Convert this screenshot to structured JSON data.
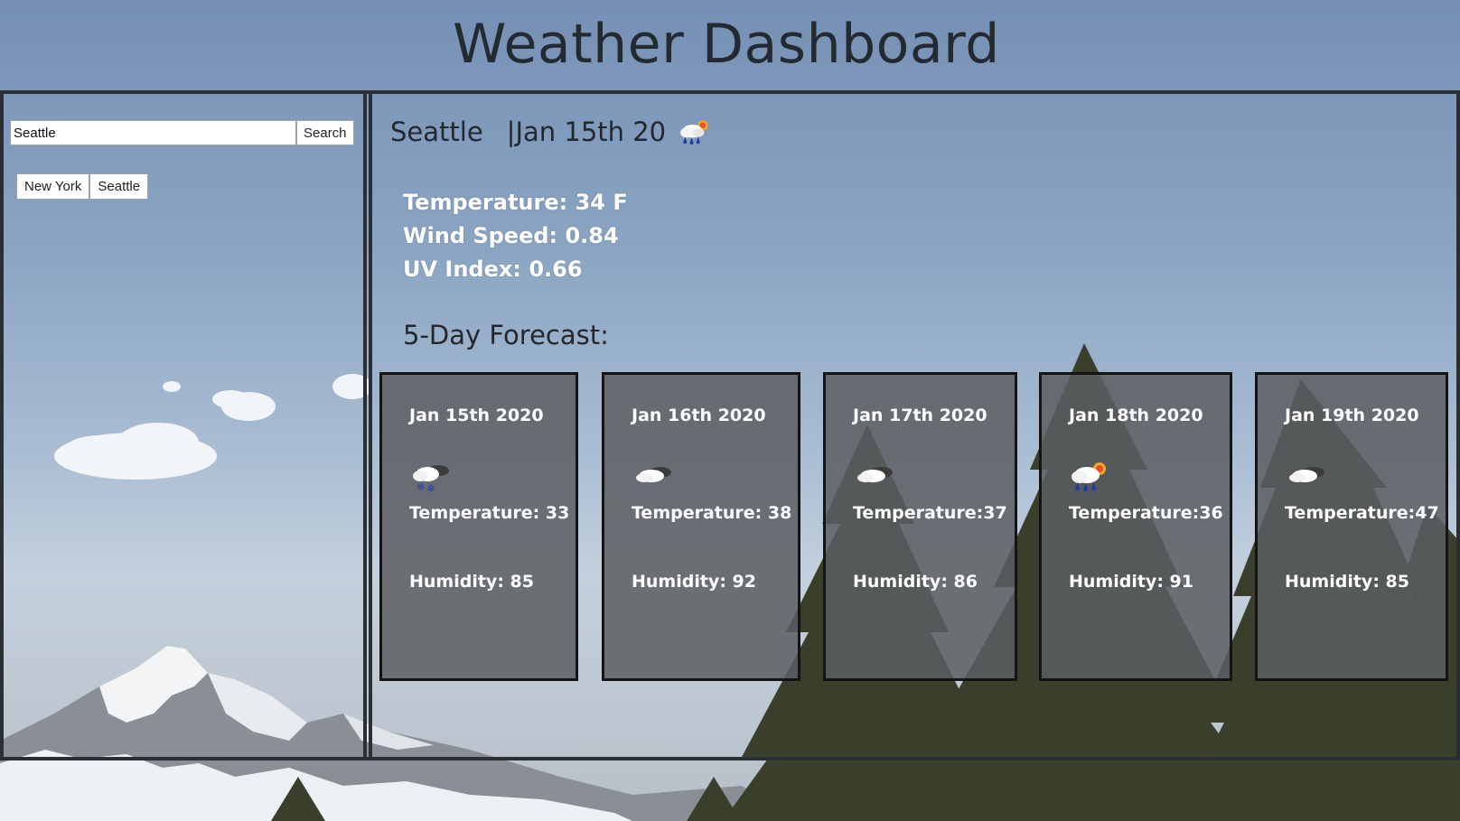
{
  "header": {
    "title": "Weather Dashboard"
  },
  "sidebar": {
    "search": {
      "value": "Seattle",
      "button_label": "Search"
    },
    "history": [
      {
        "label": "New York"
      },
      {
        "label": "Seattle"
      }
    ]
  },
  "current": {
    "city": "Seattle",
    "date": "|Jan 15th 20",
    "icon": "rain-sun-icon",
    "temperature": "Temperature: 34 F",
    "wind_speed": "Wind Speed: 0.84",
    "uv_index": "UV Index: 0.66"
  },
  "forecast": {
    "title": "5-Day Forecast:",
    "days": [
      {
        "date": "Jan 15th 2020",
        "icon": "snow-cloud-icon",
        "temperature": "Temperature: 33",
        "humidity": "Humidity: 85"
      },
      {
        "date": "Jan 16th 2020",
        "icon": "cloud-icon",
        "temperature": "Temperature: 38",
        "humidity": "Humidity: 92"
      },
      {
        "date": "Jan 17th 2020",
        "icon": "cloud-icon",
        "temperature": "Temperature:37",
        "humidity": "Humidity: 86"
      },
      {
        "date": "Jan 18th 2020",
        "icon": "rain-sun-icon",
        "temperature": "Temperature:36",
        "humidity": "Humidity: 91"
      },
      {
        "date": "Jan 19th 2020",
        "icon": "cloud-icon",
        "temperature": "Temperature:47",
        "humidity": "Humidity: 85"
      }
    ]
  }
}
